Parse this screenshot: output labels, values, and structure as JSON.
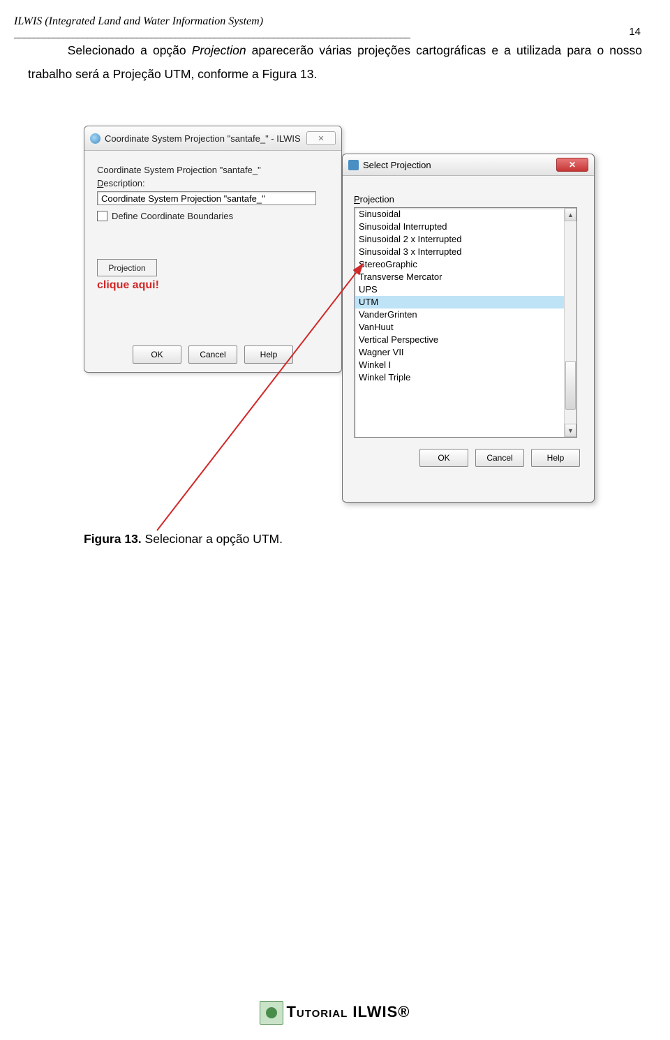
{
  "header": {
    "abbrev": "ILWIS (",
    "full": "Integrated Land and Water Information System",
    "close": ")",
    "rule": "_________________________________________________________________________________",
    "page_number": "14"
  },
  "paragraph": {
    "t1": "Selecionado  a  opção ",
    "italic": "Projection",
    "t2": "  aparecerão  várias  projeções  cartográficas  e  a utilizada para o nosso trabalho será a Projeção UTM, conforme a Figura 13."
  },
  "dialog_left": {
    "title": "Coordinate System Projection \"santafe_\" - ILWIS",
    "close_glyph": "✕",
    "name_label_prefix": "Coordinate System Projection \"santafe_\"",
    "desc_label_u": "D",
    "desc_label": "escription:",
    "desc_value": "Coordinate System Projection \"santafe_\"",
    "checkbox_label": "Define Coordinate Boundaries",
    "projection_btn_u": "P",
    "projection_btn": "rojection",
    "click_here": "clique aqui!",
    "buttons": {
      "ok": "OK",
      "cancel": "Cancel",
      "help": "Help"
    }
  },
  "dialog_right": {
    "title": "Select Projection",
    "close_glyph": "✕",
    "list_label_u": "P",
    "list_label": "rojection",
    "items": [
      "Sinusoidal",
      "Sinusoidal Interrupted",
      "Sinusoidal 2 x Interrupted",
      "Sinusoidal 3 x Interrupted",
      "StereoGraphic",
      "Transverse Mercator",
      "UPS",
      "UTM",
      "VanderGrinten",
      "VanHuut",
      "Vertical Perspective",
      "Wagner VII",
      "Winkel I",
      "Winkel Triple"
    ],
    "selected_index": 7,
    "buttons": {
      "ok": "OK",
      "cancel": "Cancel",
      "help": "Help"
    }
  },
  "caption": {
    "bold": "Figura 13.",
    "rest": " Selecionar a opção UTM."
  },
  "footer": {
    "text": "Tutorial ILWIS®"
  }
}
